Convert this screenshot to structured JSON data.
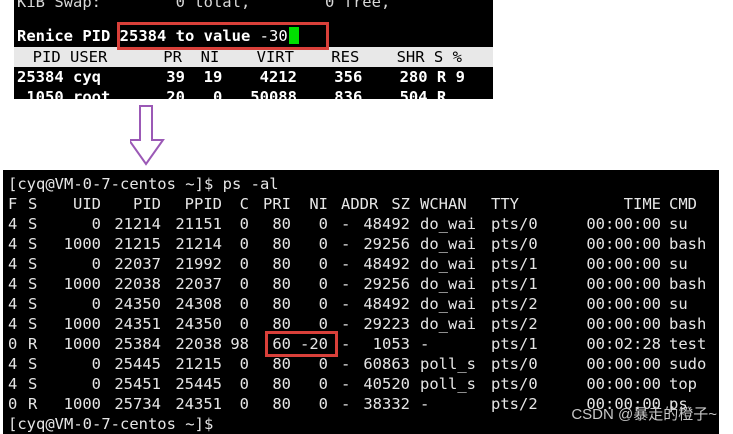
{
  "top_terminal": {
    "swap_line": "KiB Swap:        0 total,        0 free,",
    "renice_prompt": "Renice PID",
    "renice_value": "25384 to value",
    "renice_input": "-30",
    "header": "  PID USER      PR  NI    VIRT    RES    SHR S %",
    "rows": [
      "25384 cyq       39  19    4212    356    280 R 9",
      " 1050 root      20   0   50088    836    504 R"
    ]
  },
  "bottom_terminal": {
    "prompt": "[cyq@VM-0-7-centos ~]$ ps -al",
    "columns": [
      "F",
      "S",
      "UID",
      "PID",
      "PPID",
      "C",
      "PRI",
      "NI",
      "ADDR",
      "SZ",
      "WCHAN",
      "TTY",
      "TIME",
      "CMD"
    ],
    "rows": [
      [
        "4",
        "S",
        "0",
        "21214",
        "21151",
        "0",
        "80",
        "0",
        "-",
        "48492",
        "do_wai",
        "pts/0",
        "00:00:00",
        "su"
      ],
      [
        "4",
        "S",
        "1000",
        "21215",
        "21214",
        "0",
        "80",
        "0",
        "-",
        "29256",
        "do_wai",
        "pts/0",
        "00:00:00",
        "bash"
      ],
      [
        "4",
        "S",
        "0",
        "22037",
        "21992",
        "0",
        "80",
        "0",
        "-",
        "48492",
        "do_wai",
        "pts/1",
        "00:00:00",
        "su"
      ],
      [
        "4",
        "S",
        "1000",
        "22038",
        "22037",
        "0",
        "80",
        "0",
        "-",
        "29256",
        "do_wai",
        "pts/1",
        "00:00:00",
        "bash"
      ],
      [
        "4",
        "S",
        "0",
        "24350",
        "24308",
        "0",
        "80",
        "0",
        "-",
        "48492",
        "do_wai",
        "pts/2",
        "00:00:00",
        "su"
      ],
      [
        "4",
        "S",
        "1000",
        "24351",
        "24350",
        "0",
        "80",
        "0",
        "-",
        "29223",
        "do_wai",
        "pts/2",
        "00:00:00",
        "bash"
      ],
      [
        "0",
        "R",
        "1000",
        "25384",
        "22038",
        "98",
        "60",
        "-20",
        "-",
        "1053",
        "-",
        "pts/1",
        "00:02:28",
        "test"
      ],
      [
        "4",
        "S",
        "0",
        "25445",
        "21215",
        "0",
        "80",
        "0",
        "-",
        "60863",
        "poll_s",
        "pts/0",
        "00:00:00",
        "sudo"
      ],
      [
        "4",
        "S",
        "0",
        "25451",
        "25445",
        "0",
        "80",
        "0",
        "-",
        "40520",
        "poll_s",
        "pts/0",
        "00:00:00",
        "top"
      ],
      [
        "0",
        "R",
        "1000",
        "25734",
        "24351",
        "0",
        "80",
        "0",
        "-",
        "38332",
        "-",
        "pts/2",
        "00:00:00",
        "ps"
      ]
    ],
    "last_prompt": "[cyq@VM-0-7-centos ~]$"
  },
  "watermark": "CSDN @暴走的橙子~"
}
